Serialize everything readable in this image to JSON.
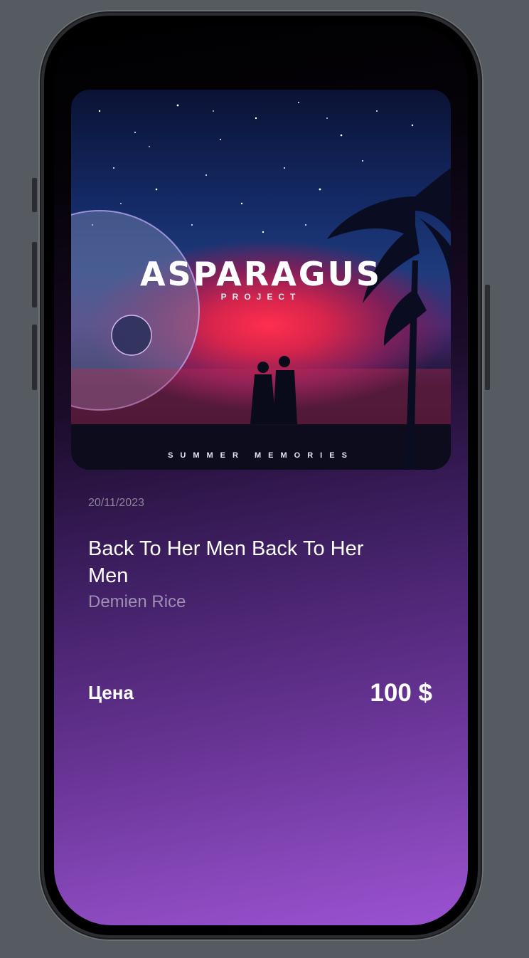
{
  "album": {
    "title": "ASPARAGUS",
    "subtitle": "PROJECT",
    "footer": "SUMMER MEMORIES"
  },
  "track": {
    "date": "20/11/2023",
    "title": "Back To Her Men Back To Her Men",
    "artist": "Demien Rice"
  },
  "price": {
    "label": "Цена",
    "value": "100 $"
  },
  "colors": {
    "background": "#565b61",
    "gradient_end": "#9b52d2",
    "date_text": "#8d839a",
    "artist_text": "#9f8fb3"
  }
}
